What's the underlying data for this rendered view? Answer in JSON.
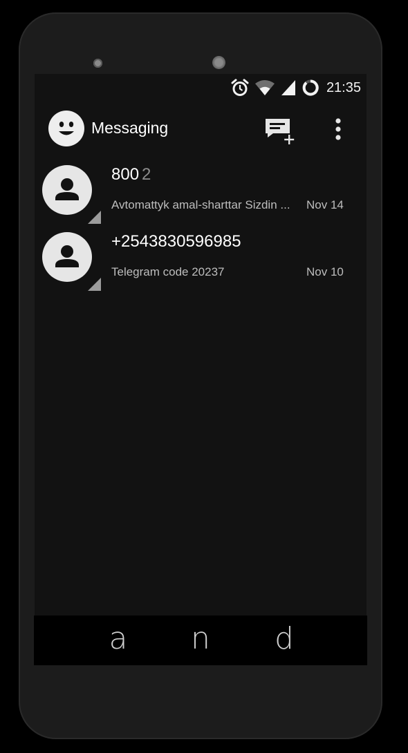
{
  "status": {
    "icons": [
      "alarm-icon",
      "wifi-icon",
      "cell-signal-icon",
      "battery-icon"
    ],
    "time": "21:35"
  },
  "app": {
    "title": "Messaging",
    "logo_icon": "smiley-icon",
    "actions": [
      "new-message-icon",
      "more-vert-icon"
    ]
  },
  "conversations": [
    {
      "name": "800",
      "count": "2",
      "snippet": "Avtomattyk amal-sharttar Sizdin ...",
      "date": "Nov 14",
      "avatar_icon": "person-icon"
    },
    {
      "name": "+2543830596985",
      "count": "",
      "snippet": "Telegram code 20237",
      "date": "Nov 10",
      "avatar_icon": "person-icon"
    }
  ],
  "navbar": {
    "back_label": "a",
    "home_label": "n",
    "recents_label": "d"
  },
  "colors": {
    "screen_bg": "#121212",
    "phone_body": "#1c1c1c",
    "avatar_bg": "#e6e6e6",
    "secondary_text": "#bdbdbd",
    "count_text": "#8d8d8d"
  }
}
